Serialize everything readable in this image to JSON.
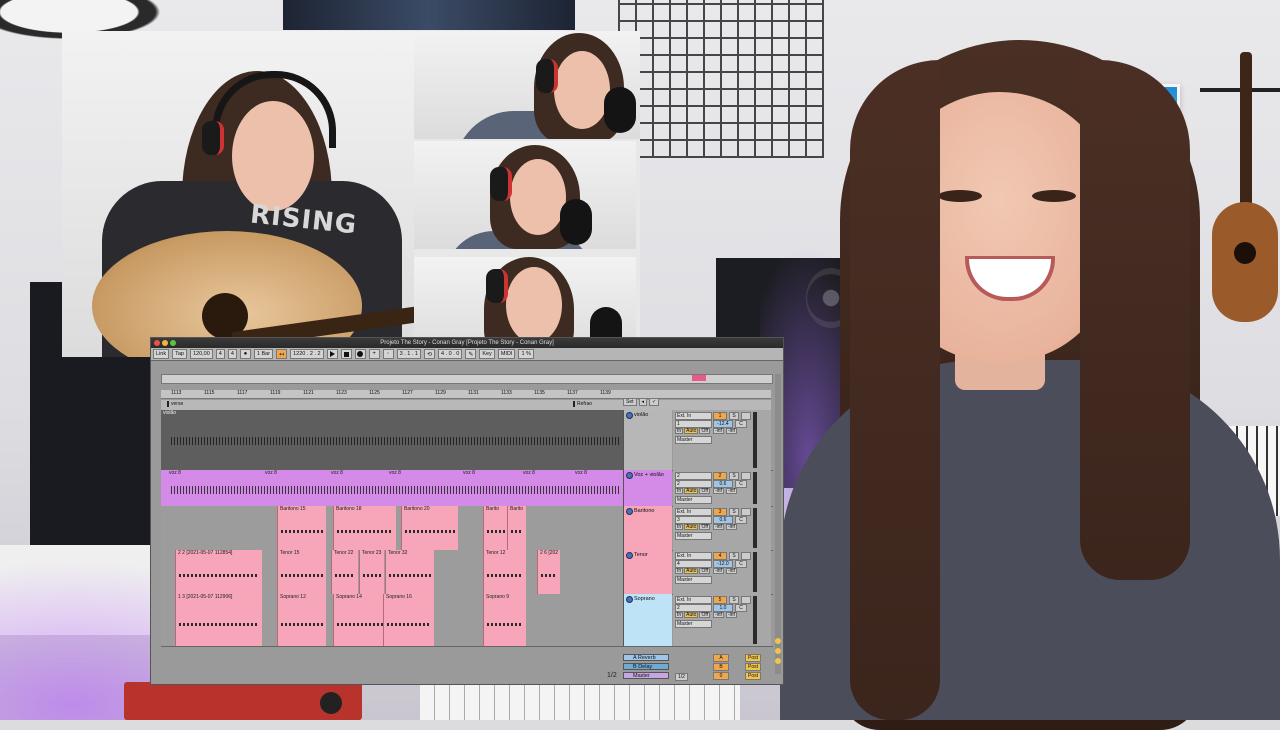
{
  "video_overlay": {
    "shirt_print": "RISING"
  },
  "daw": {
    "window_title": "Projeto The Story - Conan Gray  [Projeto The Story - Conan Gray]",
    "control_bar": {
      "link": "Link",
      "tap": "Tap",
      "tempo": "120,00",
      "sig_num": "4",
      "sig_den": "4",
      "metro": "1 Bar",
      "position": "1220 .  2 .  2",
      "loop_start": "3 .  1 .  1",
      "loop_len": "4 .  0 .  0",
      "key": "Key",
      "midi": "MIDI",
      "cpu": "1 %"
    },
    "ruler_marks": [
      "1113",
      "1115",
      "1117",
      "1119",
      "1121",
      "1123",
      "1125",
      "1127",
      "1129",
      "1131",
      "1133",
      "1135",
      "1137",
      "1139"
    ],
    "locators": [
      {
        "label": "verse"
      },
      {
        "label": "Refrao"
      }
    ],
    "set_label": "Set",
    "tracks": [
      {
        "name": "violão",
        "lane_label": "violão",
        "input": "Ext. In",
        "channel": "1",
        "number": "1",
        "solo": "S",
        "volume": "-12.4",
        "pan": "C",
        "monitor": [
          "In",
          "Auto",
          "Off"
        ],
        "sends": [
          "-inf",
          "-inf"
        ],
        "output": "Master"
      },
      {
        "name": "Voz + violão",
        "clips": [
          "voz 8",
          "voz 8",
          "voz 8",
          "voz 8",
          "voz 8",
          "voz 8",
          "voz 8"
        ],
        "input": "2",
        "channel": "2",
        "number": "2",
        "solo": "S",
        "volume": "0.6",
        "pan": "C",
        "monitor": [
          "In",
          "Auto",
          "Off"
        ],
        "sends": [
          "-inf",
          "-inf"
        ],
        "output": "Master"
      },
      {
        "name": "Baritono",
        "clips": [
          "Baritono 15",
          "Baritono 18",
          "Baritono 20",
          "Barito",
          "Barito"
        ],
        "input": "Ext. In",
        "channel": "3",
        "number": "3",
        "solo": "S",
        "volume": "0.6",
        "pan": "C",
        "monitor": [
          "In",
          "Auto",
          "Off"
        ],
        "sends": [
          "-inf",
          "-inf"
        ],
        "output": "Master"
      },
      {
        "name": "Tenor",
        "clips": [
          "2 2 [2021-05-07 112854]",
          "Tenor 15",
          "Tenor 22",
          "Tenor 23",
          "Tenor 32",
          "Tenor 12",
          "2 6 [202"
        ],
        "input": "Ext. In",
        "channel": "4",
        "number": "4",
        "solo": "S",
        "volume": "-12.0",
        "pan": "C",
        "monitor": [
          "In",
          "Auto",
          "Off"
        ],
        "sends": [
          "-inf",
          "-inf"
        ],
        "output": "Master"
      },
      {
        "name": "Soprano",
        "clips": [
          "1 3 [2021-05-07 112906]",
          "Soprano 12",
          "Soprano 14",
          "Soprano 16",
          "Soprano 9"
        ],
        "input": "Ext. In",
        "channel": "2",
        "number": "5",
        "solo": "S",
        "volume": "1.0",
        "pan": "C",
        "monitor": [
          "In",
          "Auto",
          "Off"
        ],
        "sends": [
          "-inf",
          "-inf"
        ],
        "output": "Master"
      }
    ],
    "returns": [
      {
        "name": "A Reverb",
        "number": "A",
        "post": "Post"
      },
      {
        "name": "B Delay",
        "number": "B",
        "post": "Post"
      },
      {
        "name": "Master",
        "number": "0",
        "post": "Post"
      }
    ],
    "bottom_position": "1/2",
    "bottom_ratio": "1/2"
  },
  "colors": {
    "clip_pink": "#f6a6b8",
    "voice_track": "#d48be8",
    "accent_orange": "#f0a64a",
    "soprano_head": "#bfe3f6"
  }
}
